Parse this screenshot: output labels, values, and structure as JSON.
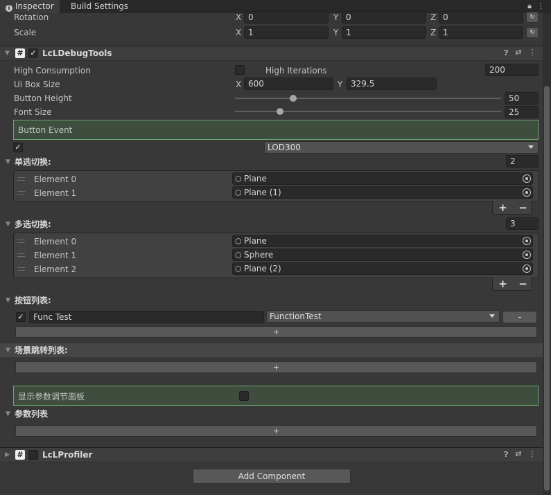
{
  "tabs": {
    "inspector": "Inspector",
    "build_settings": "Build Settings"
  },
  "transform": {
    "rotation_label": "Rotation",
    "scale_label": "Scale",
    "x_axis": "X",
    "y_axis": "Y",
    "z_axis": "Z",
    "rotation": [
      "0",
      "0",
      "0"
    ],
    "scale": [
      "1",
      "1",
      "1"
    ]
  },
  "component1": {
    "title": "LcLDebugTools",
    "enabled": true,
    "high_consumption_label": "High Consumption",
    "high_iterations_label": "High Iterations",
    "high_iterations_value": "200",
    "ui_box_size_label": "Ui Box Size",
    "ui_box_x": "600",
    "ui_box_y": "329.5",
    "button_height_label": "Button Height",
    "button_height_value": "50",
    "button_height_fraction": 0.22,
    "font_size_label": "Font Size",
    "font_size_value": "25",
    "font_size_fraction": 0.17,
    "button_event_label": "Button Event",
    "lod_value": "LOD300"
  },
  "single_switch": {
    "title": "单选切换:",
    "count": "2",
    "elements": [
      {
        "label": "Element 0",
        "value": "Plane"
      },
      {
        "label": "Element 1",
        "value": "Plane (1)"
      }
    ]
  },
  "multi_switch": {
    "title": "多选切换:",
    "count": "3",
    "elements": [
      {
        "label": "Element 0",
        "value": "Plane"
      },
      {
        "label": "Element 1",
        "value": "Sphere"
      },
      {
        "label": "Element 2",
        "value": "Plane (2)"
      }
    ]
  },
  "button_list": {
    "title": "按钮列表:",
    "name": "Func Test",
    "function": "FunctionTest",
    "remove": "-",
    "add": "+"
  },
  "scene_list": {
    "title": "场景跳转列表:",
    "add": "+"
  },
  "param_panel": {
    "label": "显示参数调节面板"
  },
  "param_list": {
    "title": "参数列表",
    "add": "+"
  },
  "component2": {
    "title": "LcLProfiler"
  },
  "add_component": "Add Component",
  "list_buttons": {
    "plus": "+",
    "minus": "−"
  }
}
